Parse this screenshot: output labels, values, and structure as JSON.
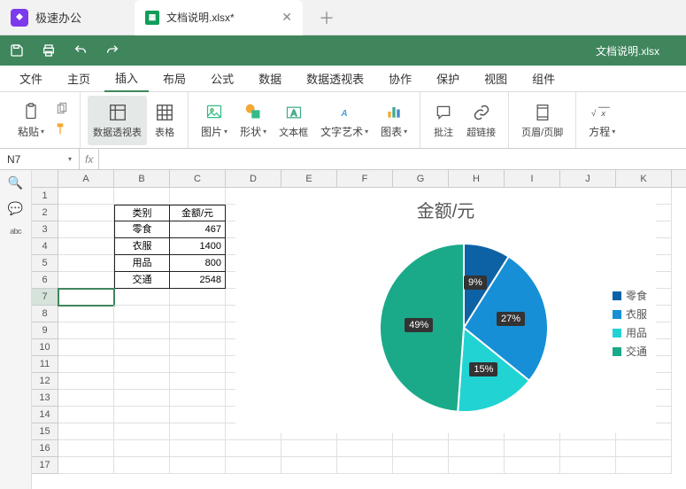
{
  "app_name": "极速办公",
  "tab": {
    "title": "文档说明.xlsx*"
  },
  "doc_title": "文档说明.xlsx",
  "menu": [
    "文件",
    "主页",
    "插入",
    "布局",
    "公式",
    "数据",
    "数据透视表",
    "协作",
    "保护",
    "视图",
    "组件"
  ],
  "menu_active_index": 2,
  "ribbon": {
    "paste": "粘贴",
    "pivot": "数据透视表",
    "table": "表格",
    "image": "图片",
    "shape": "形状",
    "textbox": "文本框",
    "wordart": "文字艺术",
    "chart": "图表",
    "comment": "批注",
    "hyperlink": "超链接",
    "headerfooter": "页眉/页脚",
    "equation": "方程"
  },
  "cell_ref": "N7",
  "columns": [
    "A",
    "B",
    "C",
    "D",
    "E",
    "F",
    "G",
    "H",
    "I",
    "J",
    "K"
  ],
  "row_count": 17,
  "selected_row": 7,
  "table": {
    "header": [
      "类别",
      "金额/元"
    ],
    "rows": [
      {
        "cat": "零食",
        "val": "467"
      },
      {
        "cat": "衣服",
        "val": "1400"
      },
      {
        "cat": "用品",
        "val": "800"
      },
      {
        "cat": "交通",
        "val": "2548"
      }
    ]
  },
  "chart_data": {
    "type": "pie",
    "title": "金额/元",
    "series": [
      {
        "name": "零食",
        "value": 467,
        "pct": "9%",
        "color": "#0d62a6"
      },
      {
        "name": "衣服",
        "value": 1400,
        "pct": "27%",
        "color": "#168fd6"
      },
      {
        "name": "用品",
        "value": 800,
        "pct": "15%",
        "color": "#22d3d3"
      },
      {
        "name": "交通",
        "value": 2548,
        "pct": "49%",
        "color": "#1aaa8a"
      }
    ]
  }
}
